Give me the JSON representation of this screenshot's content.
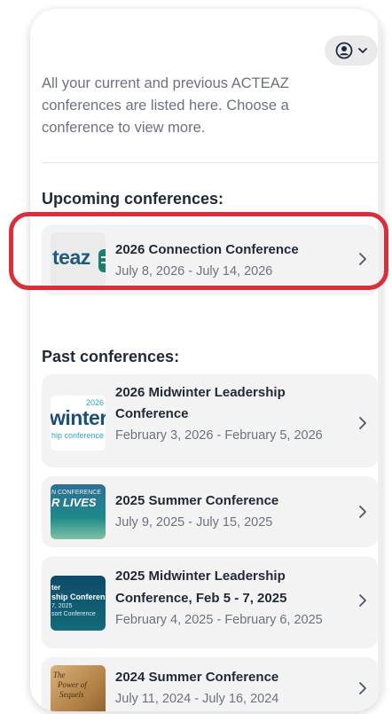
{
  "intro_text": "All your current and previous ACTEAZ conferences are listed here. Choose a conference to view more.",
  "upcoming": {
    "heading": "Upcoming conferences:",
    "items": [
      {
        "title": "2026 Connection Conference",
        "dates": "July 8, 2026 - July 14, 2026",
        "thumb_text": "teaz"
      }
    ]
  },
  "past": {
    "heading": "Past conferences:",
    "items": [
      {
        "title_line1": "2026 Midwinter Leadership",
        "title_line2": "Conference",
        "dates": "February 3, 2026 - February 5, 2026",
        "thumb_year": "2026",
        "thumb_big": "winter",
        "thumb_small": "hip conference"
      },
      {
        "title": "2025 Summer Conference",
        "dates": "July 9, 2025 - July 15, 2025",
        "thumb_top": "N CONFERENCE",
        "thumb_big": "R LIVES"
      },
      {
        "title_line1": "2025 Midwinter Leadership",
        "title_line2": "Conference, Feb 5 - 7, 2025",
        "dates": "February 4, 2025 - February 6, 2025",
        "thumb_l1": "ter",
        "thumb_l2": "ship Conferen",
        "thumb_l3": "7, 2025",
        "thumb_l4": "sort Conference"
      },
      {
        "title": "2024 Summer Conference",
        "dates": "July 11, 2024 - July 16, 2024",
        "thumb_l1": "The",
        "thumb_l2": "Power of",
        "thumb_l3": "Sequels"
      }
    ]
  },
  "colors": {
    "highlight": "#d7303c",
    "card_bg": "#f3f3f4",
    "teal_bar": "#1a7f6e"
  }
}
